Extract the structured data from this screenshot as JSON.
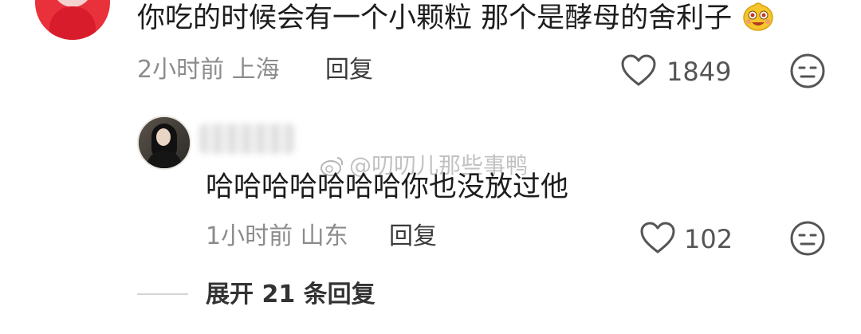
{
  "top_comment": {
    "text": "你吃的时候会有一个小颗粒 那个是酵母的舍利子",
    "emoji": "smiling-face-emoji",
    "time_location": "2小时前 上海",
    "reply_label": "回复",
    "like_count": "1849"
  },
  "reply_comment": {
    "text": "哈哈哈哈哈哈哈你也没放过他",
    "time_location": "1小时前 山东",
    "reply_label": "回复",
    "like_count": "102"
  },
  "watermark": "@叨叨儿那些事鸭",
  "expand_replies_label": "展开 21 条回复",
  "colors": {
    "text_primary": "#1d1d1d",
    "text_meta": "#8c8c8c",
    "icon_stroke": "#555555"
  }
}
